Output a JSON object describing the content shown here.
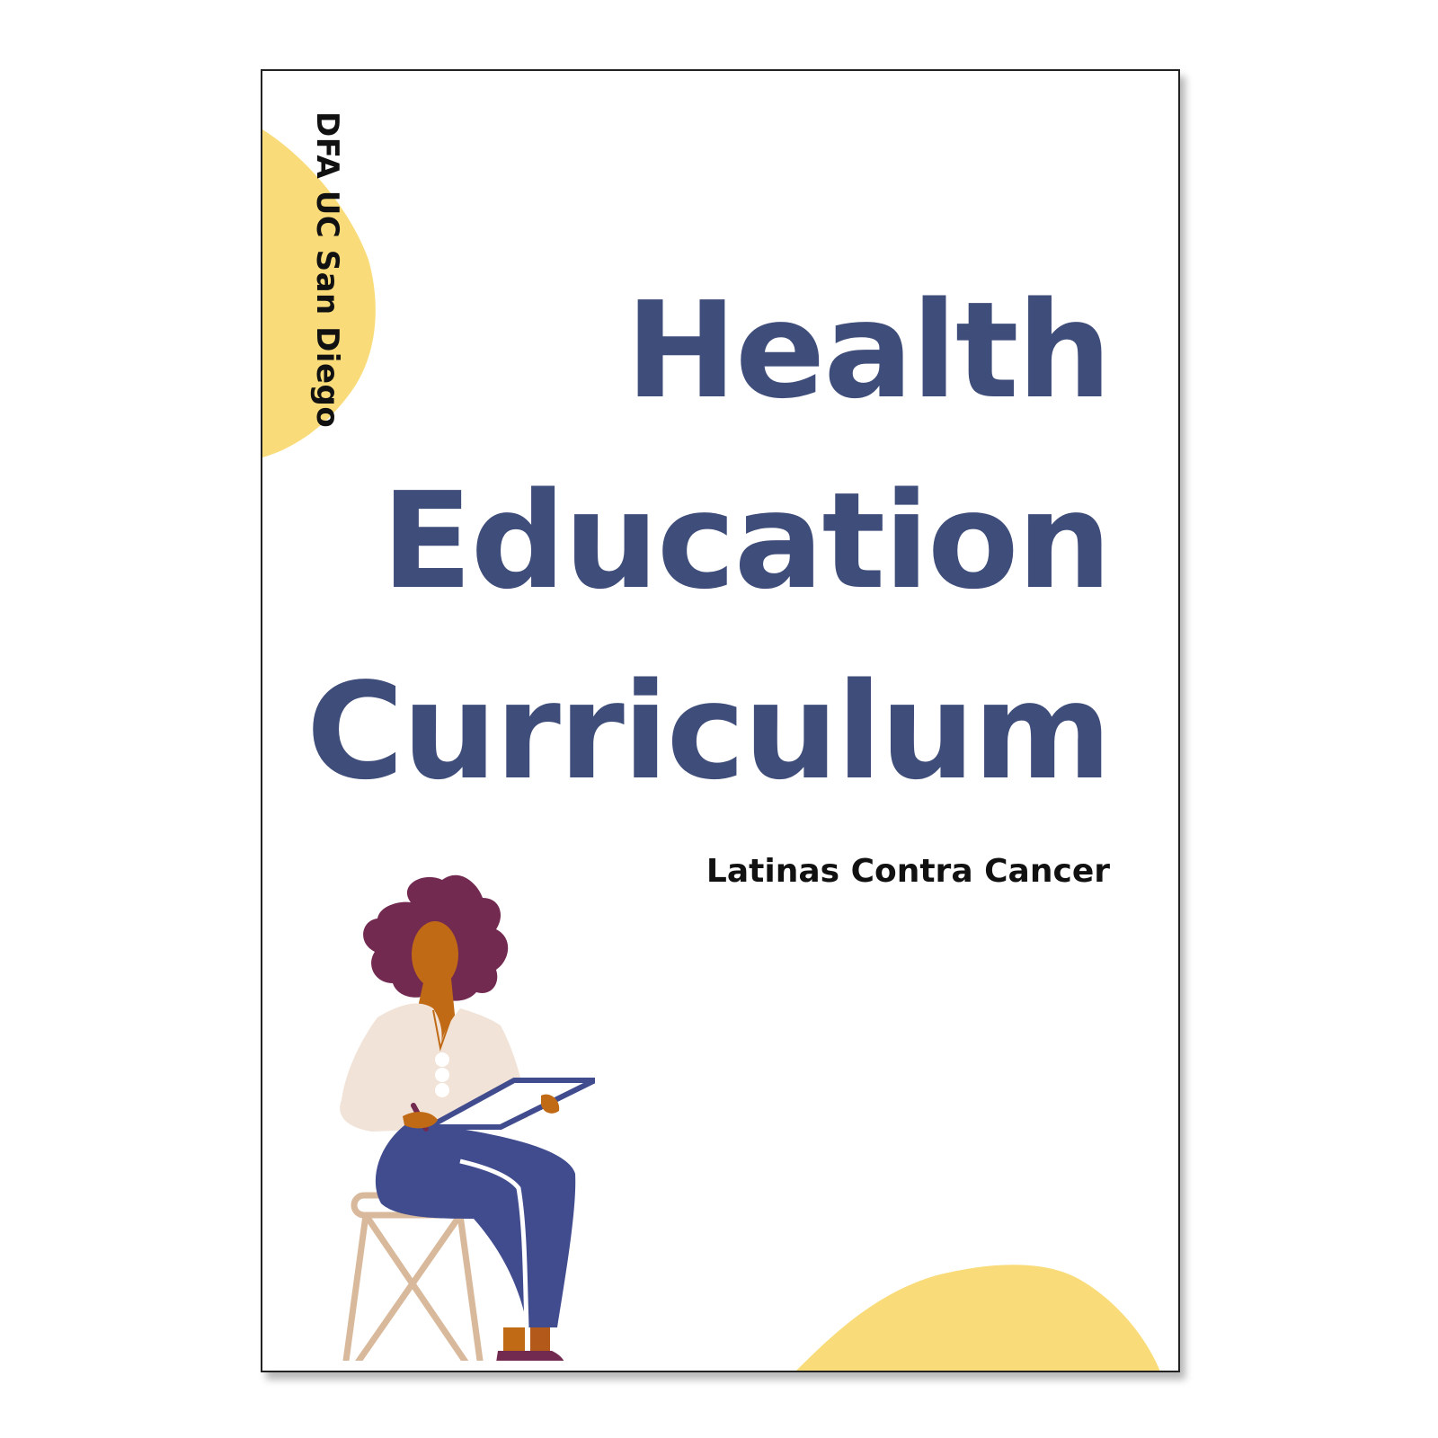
{
  "cover": {
    "side_label": "DFA UC San Diego",
    "title_lines": [
      "Health",
      "Education",
      "Curriculum"
    ],
    "subtitle": "Latinas Contra Cancer"
  },
  "colors": {
    "title": "#3f4d7a",
    "accent_blob": "#f9dc79",
    "text": "#111111"
  },
  "illustration": {
    "name": "woman-writing-on-tablet-illustration"
  }
}
